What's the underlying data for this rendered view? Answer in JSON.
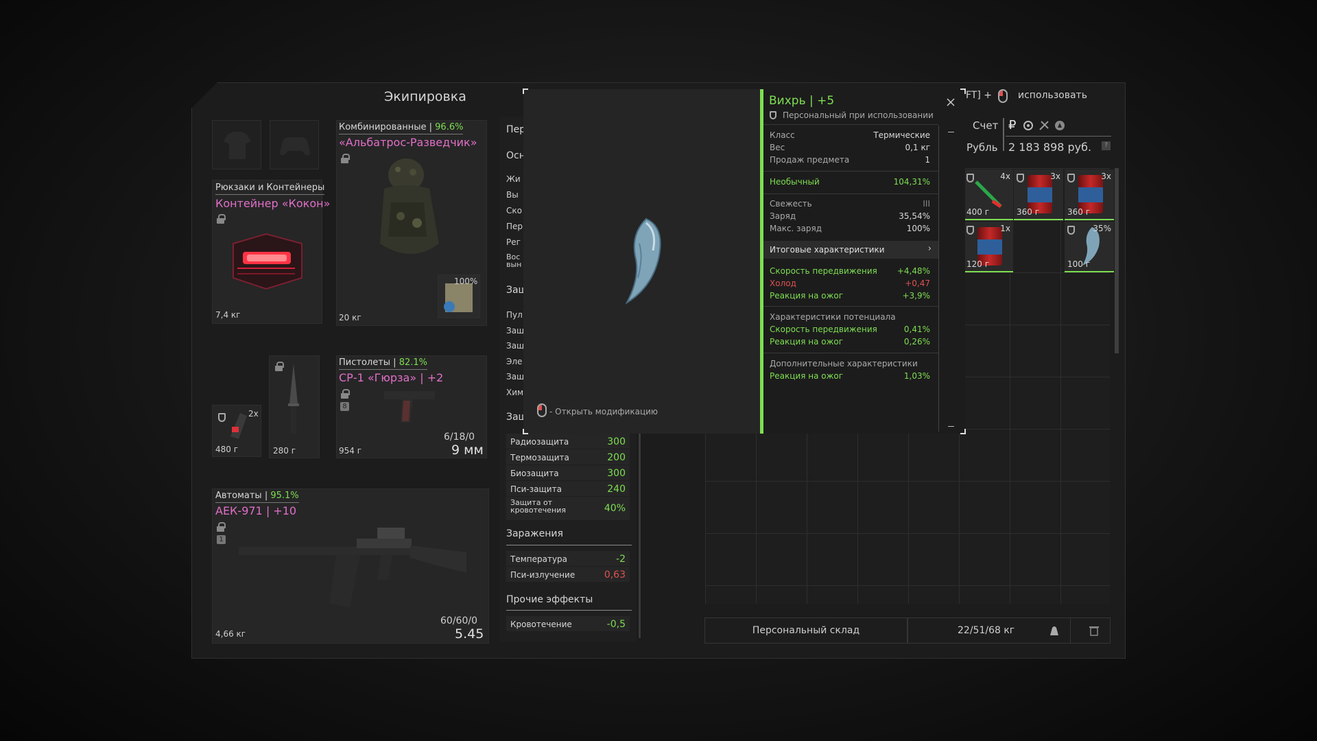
{
  "equipment": {
    "title": "Экипировка",
    "armor": {
      "category": "Комбинированные",
      "percent": "96.6%",
      "name": "«Альбатрос-Разведчик»",
      "weight": "20 кг",
      "plate_percent": "100%"
    },
    "backpack": {
      "category": "Рюкзаки и Контейнеры",
      "name": "Контейнер «Кокон»",
      "weight": "7,4 кг"
    },
    "consumable": {
      "qty": "2x",
      "weight": "480 г"
    },
    "knife": {
      "weight": "280 г"
    },
    "pistol": {
      "category": "Пистолеты",
      "percent": "82.1%",
      "name": "СР-1 «Гюрза» | +2",
      "badge": "8",
      "weight": "954 г",
      "ammo": "6/18/0",
      "caliber": "9 мм"
    },
    "rifle": {
      "category": "Автоматы",
      "percent": "95.1%",
      "name": "АЕК-971 | +10",
      "badge": "1",
      "weight": "4,66 кг",
      "ammo": "60/60/0",
      "caliber": "5.45"
    }
  },
  "stats": {
    "header_trunc": "Пер",
    "section_trunc_1": "Осн",
    "truncated_rows": [
      "Жи",
      "Вы",
      "Ско",
      "Пер",
      "Рег",
      "Вос вын"
    ],
    "section_trunc_2": "Защ",
    "truncated_rows_2": [
      "Пул",
      "Защ",
      "Защ",
      "Эле",
      "Защ",
      "Хим"
    ],
    "section_trunc_3": "Защ",
    "protection": [
      {
        "name": "Радиозащита",
        "value": "300"
      },
      {
        "name": "Термозащита",
        "value": "200"
      },
      {
        "name": "Биозащита",
        "value": "300"
      },
      {
        "name": "Пси-защита",
        "value": "240"
      },
      {
        "name": "Защита от кровотечения",
        "value": "40%"
      }
    ],
    "contamination_title": "Заражения",
    "contamination": [
      {
        "name": "Температура",
        "value": "-2"
      },
      {
        "name": "Пси-излучение",
        "value": "0,63"
      }
    ],
    "other_title": "Прочие эффекты",
    "other": [
      {
        "name": "Кровотечение",
        "value": "-0,5"
      }
    ]
  },
  "tooltip": {
    "title": "Вихрь | +5",
    "subtitle": "Персональный при использовании",
    "open_mod": "- Открыть модификацию",
    "base": [
      {
        "k": "Класс",
        "v": "Термические"
      },
      {
        "k": "Вес",
        "v": "0,1 кг"
      },
      {
        "k": "Продаж предмета",
        "v": "1"
      }
    ],
    "rarity": {
      "k": "Необычный",
      "v": "104,31%"
    },
    "charge": [
      {
        "k": "Свежесть",
        "v": "III"
      },
      {
        "k": "Заряд",
        "v": "35,54%"
      },
      {
        "k": "Макс. заряд",
        "v": "100%"
      }
    ],
    "totals_title": "Итоговые характеристики",
    "totals": [
      {
        "k": "Скорость передвижения",
        "v": "+4,48%",
        "c": "g"
      },
      {
        "k": "Холод",
        "v": "+0,47",
        "c": "r"
      },
      {
        "k": "Реакция на ожог",
        "v": "+3,9%",
        "c": "g"
      }
    ],
    "potential_title": "Характеристики потенциала",
    "potential": [
      {
        "k": "Скорость передвижения",
        "v": "0,41%"
      },
      {
        "k": "Реакция на ожог",
        "v": "0,26%"
      }
    ],
    "additional_title": "Дополнительные характеристики",
    "additional": [
      {
        "k": "Реакция на ожог",
        "v": "1,03%"
      }
    ]
  },
  "inventory": {
    "hint_key": "FT] +",
    "hint_action": "использовать",
    "account_label": "Счет",
    "currency_label": "Рубль",
    "balance": "2 183 898 руб.",
    "items": [
      {
        "qty": "4x",
        "weight": "400 г"
      },
      {
        "qty": "3x",
        "weight": "360 г"
      },
      {
        "qty": "3x",
        "weight": "360 г"
      },
      {
        "qty": "1x",
        "weight": "120 г"
      },
      {
        "qty": "35%",
        "weight": "100 г"
      }
    ],
    "storage_label": "Персональный склад",
    "capacity": "22/51/68 кг"
  },
  "colors": {
    "accent_green": "#7ede52",
    "item_name": "#e16fc8",
    "negative": "#e05050"
  }
}
